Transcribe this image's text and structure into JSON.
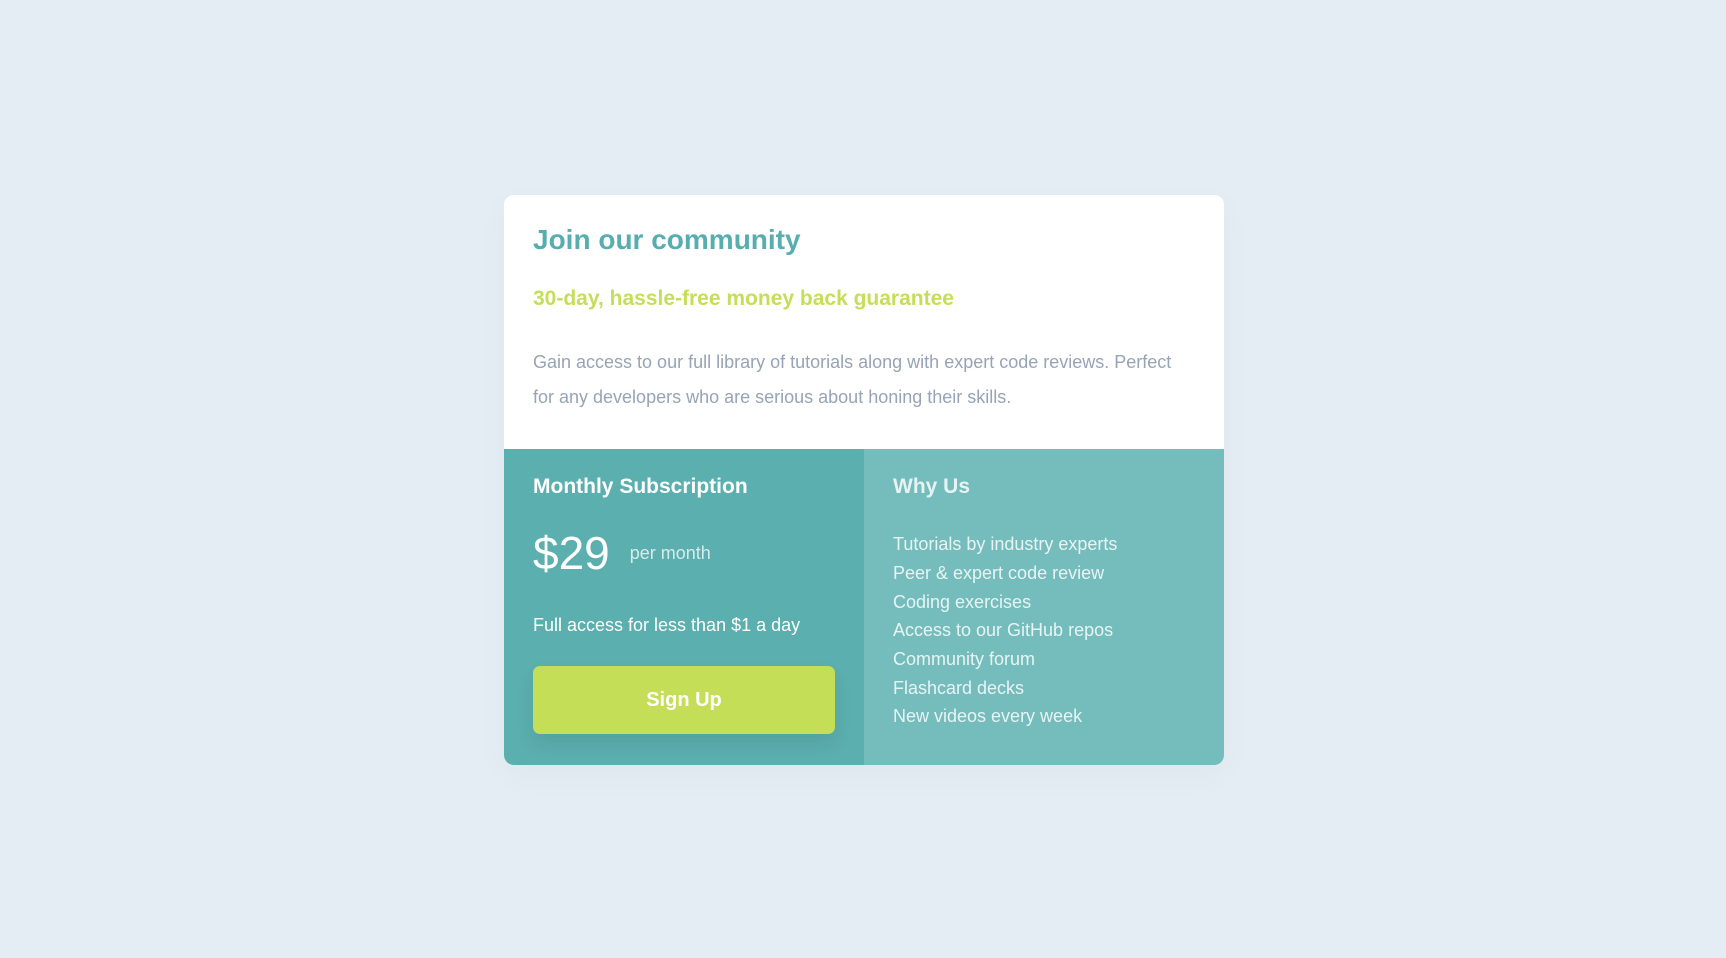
{
  "card": {
    "title": "Join our community",
    "subtitle": "30-day, hassle-free money back guarantee",
    "description": "Gain access to our full library of tutorials along with expert code reviews. Perfect for any developers who are serious about honing their skills."
  },
  "subscription": {
    "heading": "Monthly Subscription",
    "price": "$29",
    "period": "per month",
    "tagline": "Full access for less than $1 a day",
    "button_label": "Sign Up"
  },
  "why_us": {
    "heading": "Why Us",
    "items": [
      "Tutorials by industry experts",
      "Peer & expert code review",
      "Coding exercises",
      "Access to our GitHub repos",
      "Community forum",
      "Flashcard decks",
      "New videos every week"
    ]
  },
  "colors": {
    "background": "#e5edf4",
    "primary": "#57adaf",
    "accent": "#c4df57",
    "secondary_panel": "#75bcbc",
    "text_muted": "#97a3b7"
  }
}
